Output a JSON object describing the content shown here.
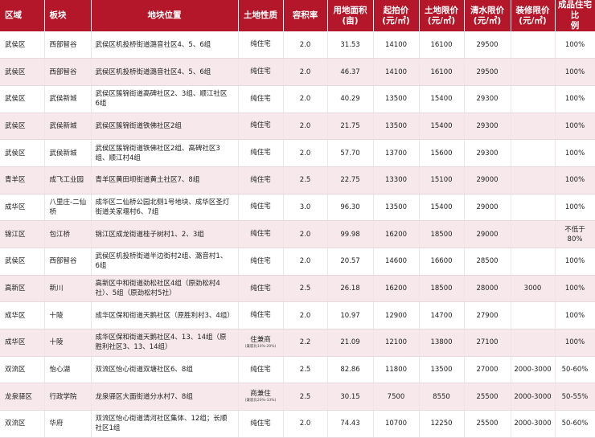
{
  "headers": {
    "district": "区域",
    "sector": "板块",
    "location": "地块位置",
    "nature": "土地性质",
    "plot_ratio": "容积率",
    "area_line1": "用地面积",
    "area_line2": "(亩)",
    "start_price_line1": "起拍价",
    "start_price_line2": "(元/㎡)",
    "land_limit_line1": "土地限价",
    "land_limit_line2": "(元/㎡)",
    "water_limit_line1": "清水限价",
    "water_limit_line2": "(元/㎡)",
    "deco_limit_line1": "装修限价",
    "deco_limit_line2": "(元/㎡)",
    "finished_ratio_line1": "成品住宅比",
    "finished_ratio_line2": "例"
  },
  "rows": [
    {
      "district": "武侯区",
      "sector": "西部智谷",
      "location": "武侯区机投桥街道潞音社区4、5、6组",
      "nature": "纯住宅",
      "nature_note": "",
      "plot_ratio": "2.0",
      "area": "31.53",
      "start_price": "14100",
      "land_limit": "16100",
      "water_limit": "29500",
      "deco_limit": "",
      "finished_ratio": "100%"
    },
    {
      "district": "武侯区",
      "sector": "西部智谷",
      "location": "武侯区机投桥街道潞音社区4、5、6组",
      "nature": "纯住宅",
      "nature_note": "",
      "plot_ratio": "2.0",
      "area": "46.37",
      "start_price": "14100",
      "land_limit": "16100",
      "water_limit": "29500",
      "deco_limit": "",
      "finished_ratio": "100%"
    },
    {
      "district": "武侯区",
      "sector": "武侯新城",
      "location": "武侯区簇锦街道高碑社区2、3组、顺江社区6组",
      "nature": "纯住宅",
      "nature_note": "",
      "plot_ratio": "2.0",
      "area": "40.29",
      "start_price": "13500",
      "land_limit": "15400",
      "water_limit": "29300",
      "deco_limit": "",
      "finished_ratio": "100%"
    },
    {
      "district": "武侯区",
      "sector": "武侯新城",
      "location": "武侯区簇锦街道铁佛社区2组",
      "nature": "纯住宅",
      "nature_note": "",
      "plot_ratio": "2.0",
      "area": "21.75",
      "start_price": "13500",
      "land_limit": "15400",
      "water_limit": "29300",
      "deco_limit": "",
      "finished_ratio": "100%"
    },
    {
      "district": "武侯区",
      "sector": "武侯新城",
      "location": "武侯区簇锦街道铁佛社区2组、高碑社区3组、顺江村4组",
      "nature": "纯住宅",
      "nature_note": "",
      "plot_ratio": "2.0",
      "area": "57.70",
      "start_price": "13700",
      "land_limit": "15600",
      "water_limit": "29300",
      "deco_limit": "",
      "finished_ratio": "100%"
    },
    {
      "district": "青羊区",
      "sector": "成飞工业园",
      "location": "青羊区黄田坝街道黄土社区7、8组",
      "nature": "纯住宅",
      "nature_note": "",
      "plot_ratio": "2.5",
      "area": "22.75",
      "start_price": "13300",
      "land_limit": "15100",
      "water_limit": "29000",
      "deco_limit": "",
      "finished_ratio": "100%"
    },
    {
      "district": "成华区",
      "sector": "八里庄-二仙桥",
      "location": "成华区二仙桥公园北侧1号地块、成华区圣灯街道关家堰村6、7组",
      "nature": "纯住宅",
      "nature_note": "",
      "plot_ratio": "3.0",
      "area": "96.30",
      "start_price": "13500",
      "land_limit": "15400",
      "water_limit": "29000",
      "deco_limit": "",
      "finished_ratio": "100%"
    },
    {
      "district": "锦江区",
      "sector": "包江桥",
      "location": "锦江区成龙街道桂子树村1、2、3组",
      "nature": "纯住宅",
      "nature_note": "",
      "plot_ratio": "2.0",
      "area": "99.98",
      "start_price": "16200",
      "land_limit": "18500",
      "water_limit": "29000",
      "deco_limit": "",
      "finished_ratio": "不低于80%"
    },
    {
      "district": "武侯区",
      "sector": "西部智谷",
      "location": "武侯区机投桥街道半边街村2组、潞音村1、6组",
      "nature": "纯住宅",
      "nature_note": "",
      "plot_ratio": "2.0",
      "area": "20.57",
      "start_price": "14600",
      "land_limit": "16600",
      "water_limit": "28500",
      "deco_limit": "",
      "finished_ratio": "100%"
    },
    {
      "district": "高新区",
      "sector": "新川",
      "location": "高新区中和街道劲松社区4组（原劲松村4社）、5组（原劲松村5社）",
      "nature": "纯住宅",
      "nature_note": "",
      "plot_ratio": "2.5",
      "area": "26.18",
      "start_price": "16200",
      "land_limit": "18500",
      "water_limit": "28000",
      "deco_limit": "3000",
      "finished_ratio": "100%"
    },
    {
      "district": "成华区",
      "sector": "十陵",
      "location": "成华区保和街道天鹅社区（原胜利村3、4组）",
      "nature": "纯住宅",
      "nature_note": "",
      "plot_ratio": "2.0",
      "area": "10.97",
      "start_price": "12900",
      "land_limit": "14700",
      "water_limit": "27900",
      "deco_limit": "",
      "finished_ratio": "100%"
    },
    {
      "district": "成华区",
      "sector": "十陵",
      "location": "成华区保和街道天鹅社区4、13、14组（原胜利社区3、13、14组）",
      "nature": "住兼商",
      "nature_note": "(兼容比10%-20%)",
      "plot_ratio": "2.2",
      "area": "21.09",
      "start_price": "12100",
      "land_limit": "13800",
      "water_limit": "27100",
      "deco_limit": "",
      "finished_ratio": "100%"
    },
    {
      "district": "双流区",
      "sector": "怡心湖",
      "location": "双流区怡心街道双塘社区6、8组",
      "nature": "纯住宅",
      "nature_note": "",
      "plot_ratio": "2.5",
      "area": "82.86",
      "start_price": "11800",
      "land_limit": "13500",
      "water_limit": "27000",
      "deco_limit": "2000-3000",
      "finished_ratio": "50-60%"
    },
    {
      "district": "龙泉驿区",
      "sector": "行政学院",
      "location": "龙泉驿区大面街道分水村7、8组",
      "nature": "商兼住",
      "nature_note": "(兼容比20%-33%)",
      "plot_ratio": "2.5",
      "area": "30.15",
      "start_price": "7500",
      "land_limit": "8550",
      "water_limit": "25500",
      "deco_limit": "2000-3000",
      "finished_ratio": "50-55%"
    },
    {
      "district": "双流区",
      "sector": "华府",
      "location": "双流区怡心街道清河社区集体、12组；长顺社区1组",
      "nature": "纯住宅",
      "nature_note": "",
      "plot_ratio": "2.0",
      "area": "74.43",
      "start_price": "10700",
      "land_limit": "12250",
      "water_limit": "25500",
      "deco_limit": "2000-3000",
      "finished_ratio": "50-60%"
    }
  ]
}
